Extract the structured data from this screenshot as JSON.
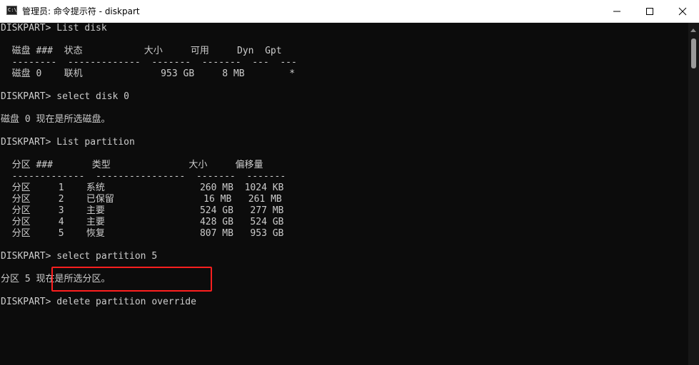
{
  "window": {
    "title": "管理员: 命令提示符 - diskpart",
    "icon": "cmd-icon",
    "icon_glyph": "C:\\",
    "controls": [
      "minimize-icon",
      "maximize-icon",
      "close-icon"
    ]
  },
  "console": {
    "lines": [
      "DISKPART> List disk",
      "",
      "  磁盘 ###  状态           大小     可用     Dyn  Gpt",
      "  --------  -------------  -------  -------  ---  ---",
      "  磁盘 0    联机              953 GB     8 MB        *",
      "",
      "DISKPART> select disk 0",
      "",
      "磁盘 0 现在是所选磁盘。",
      "",
      "DISKPART> List partition",
      "",
      "  分区 ###       类型              大小     偏移量",
      "  -------------  ----------------  -------  -------",
      "  分区     1    系统                 260 MB  1024 KB",
      "  分区     2    已保留                16 MB   261 MB",
      "  分区     3    主要                 524 GB   277 MB",
      "  分区     4    主要                 428 GB   524 GB",
      "  分区     5    恢复                 807 MB   953 GB",
      "",
      "DISKPART> select partition 5",
      "",
      "分区 5 现在是所选分区。",
      "",
      "DISKPART> delete partition override"
    ]
  },
  "colors": {
    "console_bg": "#0c0c0c",
    "console_text": "#cccccc",
    "titlebar_bg": "#ffffff",
    "highlight_border": "#ff1f1f"
  }
}
